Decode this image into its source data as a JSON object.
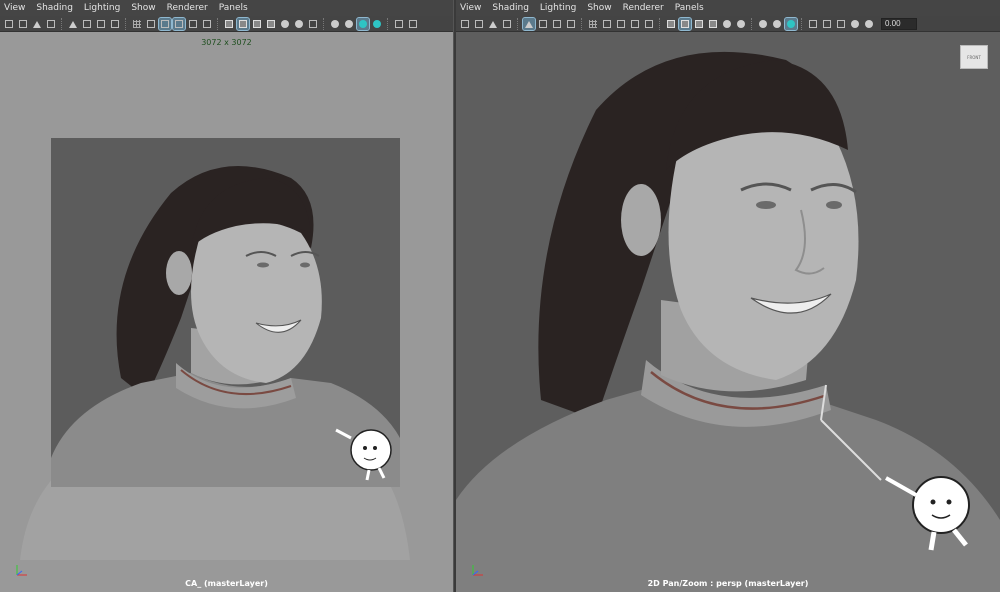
{
  "left_panel": {
    "menu": [
      "View",
      "Shading",
      "Lighting",
      "Show",
      "Renderer",
      "Panels"
    ],
    "resolution_label": "3072 x 3072",
    "viewport_label": "CA_ (masterLayer)",
    "resolution_color": "#1f4f1f"
  },
  "right_panel": {
    "menu": [
      "View",
      "Shading",
      "Lighting",
      "Show",
      "Renderer",
      "Panels"
    ],
    "exposure_value": "0.00",
    "viewport_label": "2D Pan/Zoom : persp (masterLayer)",
    "viewcube_label": "FRONT",
    "accent_color": "#2ec4c4"
  },
  "icons": [
    "camera-icon",
    "grid-icon",
    "wireframe-icon",
    "smooth-shade-icon",
    "textured-icon",
    "lighting-icon",
    "shadow-icon",
    "isolate-icon",
    "xray-icon",
    "exposure-icon"
  ]
}
